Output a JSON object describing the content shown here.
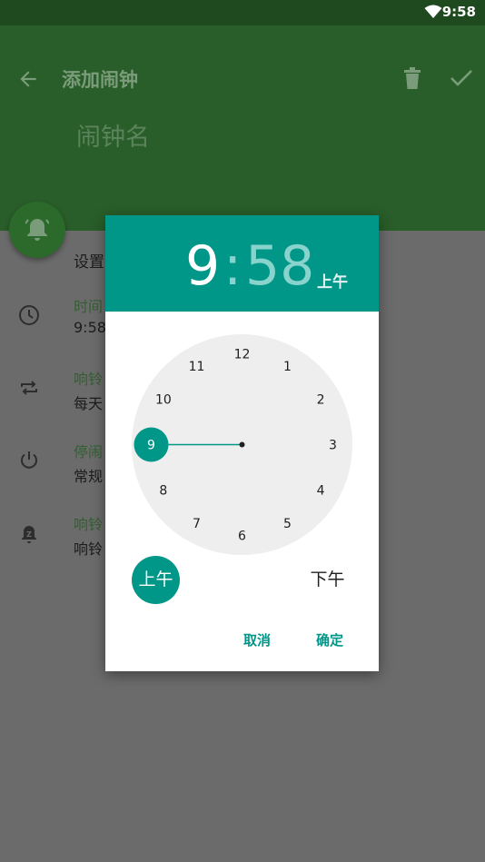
{
  "status_bar": {
    "time": "9:58"
  },
  "app_bar": {
    "title": "添加闹钟",
    "name_placeholder": "闹钟名"
  },
  "settings": {
    "heading": "设置",
    "rows": [
      {
        "title": "时间",
        "subtitle": "9:58",
        "icon": "clock-icon"
      },
      {
        "title": "响铃",
        "subtitle": "每天",
        "icon": "repeat-icon"
      },
      {
        "title": "停闹",
        "subtitle": "常规",
        "icon": "power-icon"
      },
      {
        "title": "响铃",
        "subtitle": "响铃",
        "icon": "snooze-icon"
      }
    ]
  },
  "time_picker": {
    "hour": "9",
    "colon": ":",
    "minute": "58",
    "period": "上午",
    "selected_hour": 9,
    "clock_numbers": [
      "12",
      "1",
      "2",
      "3",
      "4",
      "5",
      "6",
      "7",
      "8",
      "9",
      "10",
      "11"
    ],
    "am_label": "上午",
    "pm_label": "下午",
    "cancel_label": "取消",
    "ok_label": "确定"
  },
  "colors": {
    "accent": "#009688",
    "app_bar_dimmed": "#295d29",
    "status_bar": "#1f4a1f",
    "scrim": "#6b6b6b"
  }
}
